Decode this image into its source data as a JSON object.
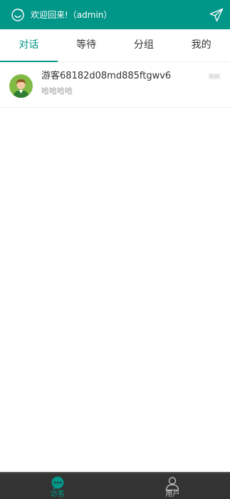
{
  "header": {
    "welcome_text": "欢迎回来!（admin）",
    "logo_icon": "smiley-logo-icon",
    "send_icon": "paper-plane-icon",
    "background_color": "#009688"
  },
  "tabs": [
    {
      "label": "对话",
      "active": true
    },
    {
      "label": "等待",
      "active": false
    },
    {
      "label": "分组",
      "active": false
    },
    {
      "label": "我的",
      "active": false
    }
  ],
  "conversations": [
    {
      "name": "游客68182d08md885ftgwv6",
      "last_message": "哈哈哈哈",
      "time": "刚刚",
      "avatar_icon": "visitor-avatar-icon"
    }
  ],
  "bottom_nav": [
    {
      "label": "访客",
      "icon": "chat-bubble-icon",
      "active": true
    },
    {
      "label": "用户",
      "icon": "user-icon",
      "active": false
    }
  ],
  "colors": {
    "accent": "#009688",
    "nav_background": "#333333"
  }
}
